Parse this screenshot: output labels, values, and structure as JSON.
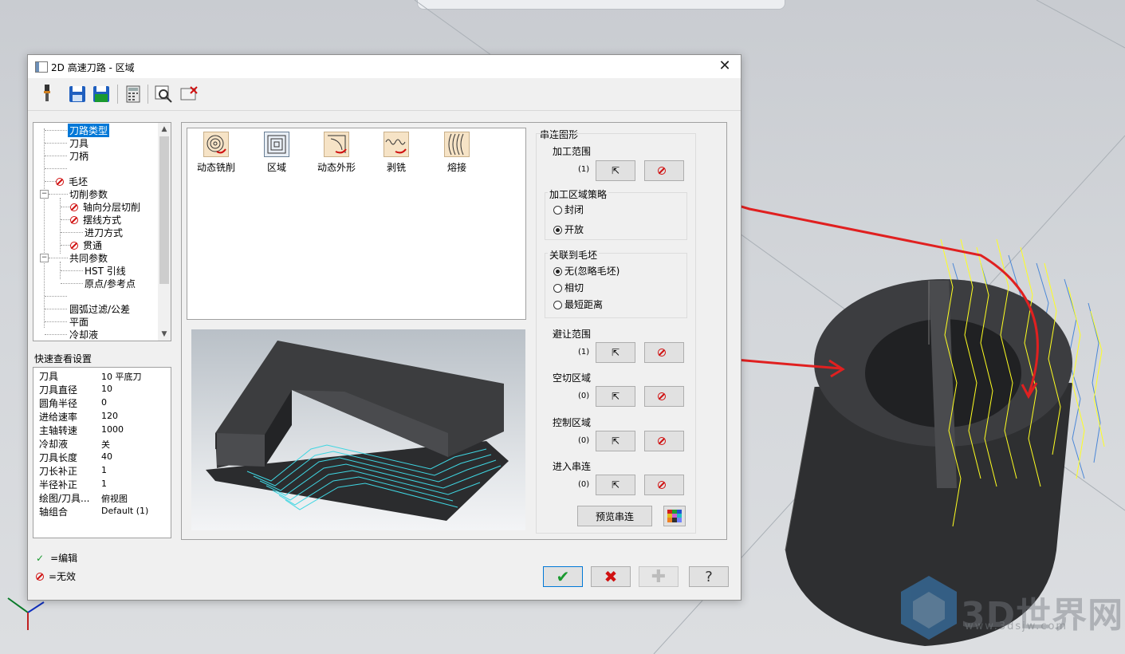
{
  "window": {
    "title": "2D 高速刀路 - 区域",
    "close_label": "✕"
  },
  "toolbar": {
    "icons": [
      "tool-icon",
      "save-icon",
      "save-as-icon",
      "calculator-icon",
      "preview-icon",
      "close-doc-icon"
    ]
  },
  "tree": {
    "items": [
      {
        "label": "刀路类型",
        "selected": true,
        "error": false
      },
      {
        "label": "刀具",
        "error": false
      },
      {
        "label": "刀柄",
        "error": false
      },
      {
        "label": "毛坯",
        "error": true
      },
      {
        "label": "切削参数",
        "error": false,
        "expander": "−"
      },
      {
        "label": "轴向分层切削",
        "error": true
      },
      {
        "label": "摆线方式",
        "error": true
      },
      {
        "label": "进刀方式",
        "error": false
      },
      {
        "label": "贯通",
        "error": true
      },
      {
        "label": "共同参数",
        "error": false,
        "expander": "−"
      },
      {
        "label": "HST 引线",
        "error": false
      },
      {
        "label": "原点/参考点",
        "error": false
      },
      {
        "label": "圆弧过滤/公差",
        "error": false
      },
      {
        "label": "平面",
        "error": false
      },
      {
        "label": "冷却液",
        "error": false
      }
    ]
  },
  "quick_view": {
    "label": "快速查看设置",
    "rows": [
      {
        "k": "刀具",
        "v": "10 平底刀"
      },
      {
        "k": "刀具直径",
        "v": "10"
      },
      {
        "k": "圆角半径",
        "v": "0"
      },
      {
        "k": "进给速率",
        "v": "120"
      },
      {
        "k": "主轴转速",
        "v": "1000"
      },
      {
        "k": "冷却液",
        "v": "关"
      },
      {
        "k": "刀具长度",
        "v": "40"
      },
      {
        "k": "刀长补正",
        "v": "1"
      },
      {
        "k": "半径补正",
        "v": "1"
      },
      {
        "k": "绘图/刀具...",
        "v": "俯视图"
      },
      {
        "k": "轴组合",
        "v": "Default (1)"
      }
    ]
  },
  "legend": {
    "edit": "=编辑",
    "invalid": "=无效"
  },
  "toolpath_types": [
    "动态铣削",
    "区域",
    "动态外形",
    "剥铣",
    "熔接"
  ],
  "chain": {
    "group_label": "串连图形",
    "machining_range": {
      "label": "加工范围",
      "count": "(1)"
    },
    "strategy": {
      "label": "加工区域策略",
      "options": [
        "封闭",
        "开放"
      ],
      "selected": "开放"
    },
    "stock": {
      "label": "关联到毛坯",
      "options": [
        "无(忽略毛坯)",
        "相切",
        "最短距离"
      ],
      "selected": "无(忽略毛坯)"
    },
    "avoid": {
      "label": "避让范围",
      "count": "(1)"
    },
    "air": {
      "label": "空切区域",
      "count": "(0)"
    },
    "control": {
      "label": "控制区域",
      "count": "(0)"
    },
    "entry": {
      "label": "进入串连",
      "count": "(0)"
    },
    "preview_button": "预览串连"
  },
  "watermark": {
    "brand": "3D世界网",
    "url": "www.3dsjw.com"
  },
  "colors": {
    "accent": "#0078d7",
    "error": "#d01010",
    "annotation": "#e02020",
    "toolpath": "#ffff00"
  }
}
